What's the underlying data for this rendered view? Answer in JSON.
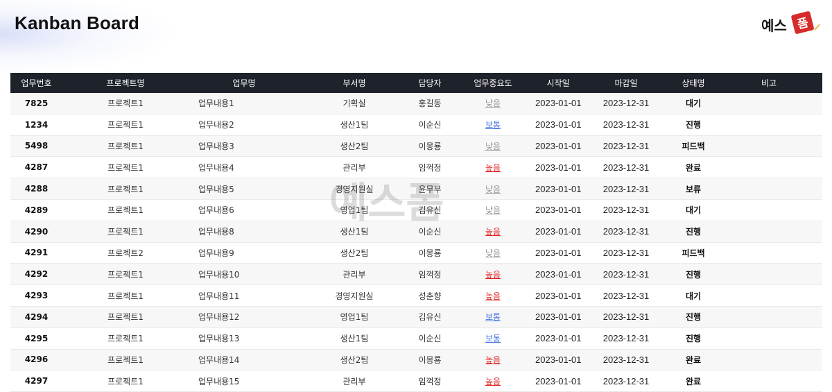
{
  "header": {
    "title": "Kanban Board",
    "logo_text": "예스폼"
  },
  "colors": {
    "header_bg": "#1e222b",
    "priority_low": "#9a9a9a",
    "priority_mid": "#4a78e0",
    "priority_high": "#e02424",
    "logo_red": "#d62b2b"
  },
  "table": {
    "columns": [
      "업무번호",
      "프로젝트명",
      "업무명",
      "부서명",
      "담당자",
      "업무중요도",
      "시작일",
      "마감일",
      "상태명",
      "비고"
    ],
    "rows": [
      {
        "id": "7825",
        "project": "프로젝트1",
        "task": "업무내용1",
        "dept": "기획실",
        "owner": "홍길동",
        "priority": "낮음",
        "start": "2023-01-01",
        "end": "2023-12-31",
        "status": "대기",
        "note": ""
      },
      {
        "id": "1234",
        "project": "프로젝트1",
        "task": "업무내용2",
        "dept": "생산1팀",
        "owner": "이순신",
        "priority": "보통",
        "start": "2023-01-01",
        "end": "2023-12-31",
        "status": "진행",
        "note": ""
      },
      {
        "id": "5498",
        "project": "프로젝트1",
        "task": "업무내용3",
        "dept": "생산2팀",
        "owner": "이몽룡",
        "priority": "낮음",
        "start": "2023-01-01",
        "end": "2023-12-31",
        "status": "피드백",
        "note": ""
      },
      {
        "id": "4287",
        "project": "프로젝트1",
        "task": "업무내용4",
        "dept": "관리부",
        "owner": "임꺽정",
        "priority": "높음",
        "start": "2023-01-01",
        "end": "2023-12-31",
        "status": "완료",
        "note": ""
      },
      {
        "id": "4288",
        "project": "프로젝트1",
        "task": "업무내용5",
        "dept": "경영지원실",
        "owner": "윤무부",
        "priority": "낮음",
        "start": "2023-01-01",
        "end": "2023-12-31",
        "status": "보류",
        "note": ""
      },
      {
        "id": "4289",
        "project": "프로젝트1",
        "task": "업무내용6",
        "dept": "영업1팀",
        "owner": "김유신",
        "priority": "낮음",
        "start": "2023-01-01",
        "end": "2023-12-31",
        "status": "대기",
        "note": ""
      },
      {
        "id": "4290",
        "project": "프로젝트1",
        "task": "업무내용8",
        "dept": "생산1팀",
        "owner": "이순신",
        "priority": "높음",
        "start": "2023-01-01",
        "end": "2023-12-31",
        "status": "진행",
        "note": ""
      },
      {
        "id": "4291",
        "project": "프로젝트2",
        "task": "업무내용9",
        "dept": "생산2팀",
        "owner": "이몽룡",
        "priority": "낮음",
        "start": "2023-01-01",
        "end": "2023-12-31",
        "status": "피드백",
        "note": ""
      },
      {
        "id": "4292",
        "project": "프로젝트1",
        "task": "업무내용10",
        "dept": "관리부",
        "owner": "임꺽정",
        "priority": "높음",
        "start": "2023-01-01",
        "end": "2023-12-31",
        "status": "진행",
        "note": ""
      },
      {
        "id": "4293",
        "project": "프로젝트1",
        "task": "업무내용11",
        "dept": "경영지원실",
        "owner": "성춘향",
        "priority": "높음",
        "start": "2023-01-01",
        "end": "2023-12-31",
        "status": "대기",
        "note": ""
      },
      {
        "id": "4294",
        "project": "프로젝트1",
        "task": "업무내용12",
        "dept": "영업1팀",
        "owner": "김유신",
        "priority": "보통",
        "start": "2023-01-01",
        "end": "2023-12-31",
        "status": "진행",
        "note": ""
      },
      {
        "id": "4295",
        "project": "프로젝트1",
        "task": "업무내용13",
        "dept": "생산1팀",
        "owner": "이순신",
        "priority": "보통",
        "start": "2023-01-01",
        "end": "2023-12-31",
        "status": "진행",
        "note": ""
      },
      {
        "id": "4296",
        "project": "프로젝트1",
        "task": "업무내용14",
        "dept": "생산2팀",
        "owner": "이몽룡",
        "priority": "높음",
        "start": "2023-01-01",
        "end": "2023-12-31",
        "status": "완료",
        "note": ""
      },
      {
        "id": "4297",
        "project": "프로젝트1",
        "task": "업무내용15",
        "dept": "관리부",
        "owner": "임꺽정",
        "priority": "높음",
        "start": "2023-01-01",
        "end": "2023-12-31",
        "status": "완료",
        "note": ""
      }
    ]
  }
}
